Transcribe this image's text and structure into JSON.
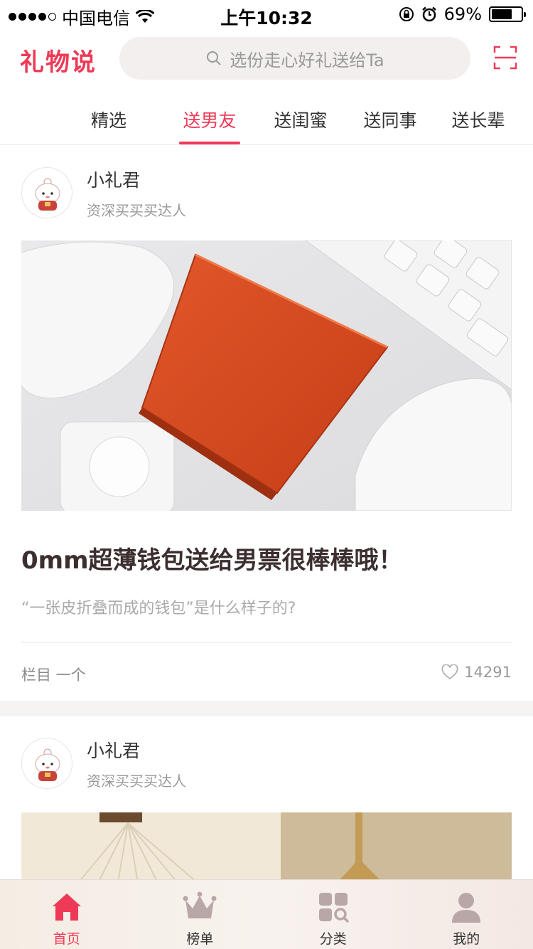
{
  "status_bar": {
    "carrier": "中国电信",
    "time": "上午10:32",
    "battery_percent": "69%",
    "battery_level": 0.69,
    "signal_icon": "signal-dots-icon",
    "wifi_icon": "wifi-icon",
    "rotation_lock_icon": "rotation-lock-icon",
    "alarm_icon": "alarm-icon"
  },
  "header": {
    "logo": "礼物说",
    "search_placeholder": "选份走心好礼送给Ta",
    "scan_icon": "scan-icon",
    "accent_color": "#ee3a57"
  },
  "tabs": [
    {
      "label": "精选",
      "active": false
    },
    {
      "label": "送男友",
      "active": true
    },
    {
      "label": "送闺蜜",
      "active": false
    },
    {
      "label": "送同事",
      "active": false
    },
    {
      "label": "送长辈",
      "active": false
    }
  ],
  "feed": [
    {
      "author_name": "小礼君",
      "author_title": "资深买买买达人",
      "title": "0mm超薄钱包送给男票很棒棒哦！",
      "description": "“一张皮折叠而成的钱包”是什么样子的?",
      "column": "栏目 一个",
      "likes": "14291"
    },
    {
      "author_name": "小礼君",
      "author_title": "资深买买买达人"
    }
  ],
  "tabbar": [
    {
      "label": "首页",
      "icon": "home-icon",
      "active": true
    },
    {
      "label": "榜单",
      "icon": "crown-icon",
      "active": false
    },
    {
      "label": "分类",
      "icon": "category-icon",
      "active": false
    },
    {
      "label": "我的",
      "icon": "profile-icon",
      "active": false
    }
  ]
}
